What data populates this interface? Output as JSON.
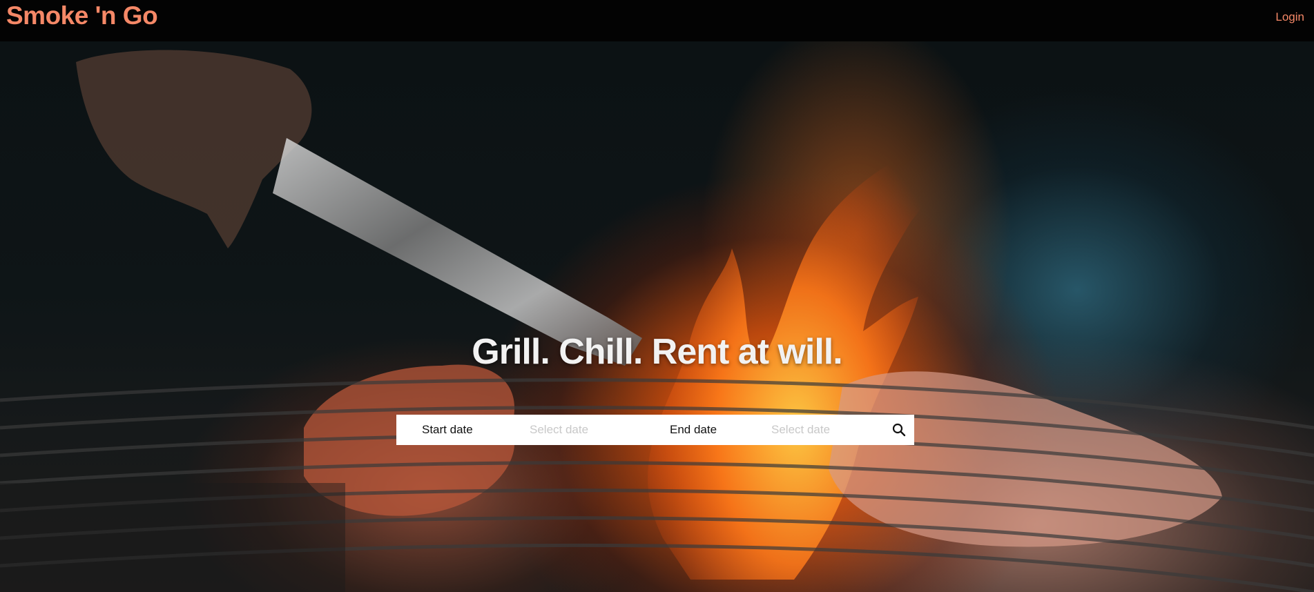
{
  "header": {
    "brand": "Smoke 'n Go",
    "login_label": "Login"
  },
  "hero": {
    "title": "Grill. Chill. Rent at will."
  },
  "search": {
    "start_label": "Start date",
    "start_placeholder": "Select date",
    "end_label": "End date",
    "end_placeholder": "Select date",
    "search_icon": "search-icon"
  },
  "colors": {
    "brand": "#f58867",
    "navbar": "#030303",
    "title": "#f2f2f2"
  }
}
